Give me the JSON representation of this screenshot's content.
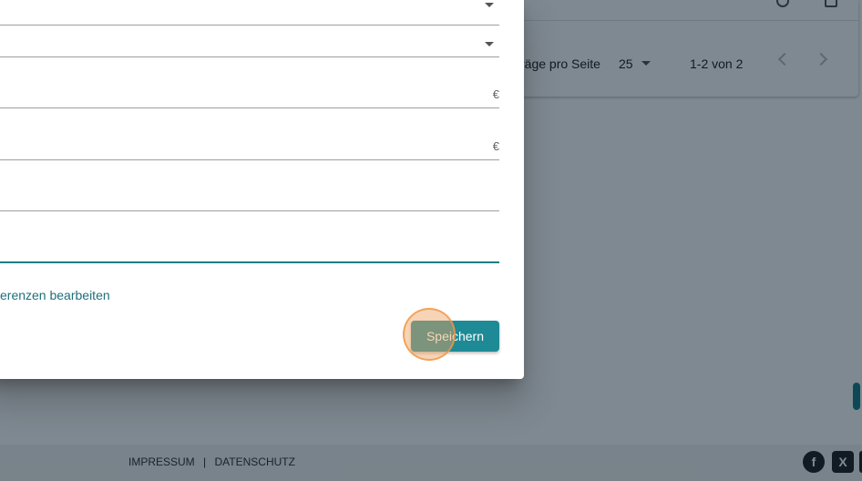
{
  "pagination": {
    "per_page_label": "räge pro Seite",
    "per_page_value": "25",
    "range_label": "1-2 von 2"
  },
  "dialog": {
    "fields": [
      {
        "type": "select"
      },
      {
        "type": "select"
      },
      {
        "type": "currency",
        "suffix": "€"
      },
      {
        "type": "currency",
        "suffix": "€"
      },
      {
        "type": "text"
      },
      {
        "type": "text",
        "state": "focused"
      }
    ],
    "link_label": "erenzen bearbeiten",
    "save_label": "Speichern"
  },
  "footer": {
    "impressum": "IMPRESSUM",
    "separator": "|",
    "datenschutz": "DATENSCHUTZ",
    "social_icons": [
      "facebook-icon",
      "xing-icon"
    ],
    "facebook_glyph": "f",
    "xing_glyph": "X"
  },
  "colors": {
    "accent": "#1e8a96",
    "link": "#1f6f7a"
  }
}
